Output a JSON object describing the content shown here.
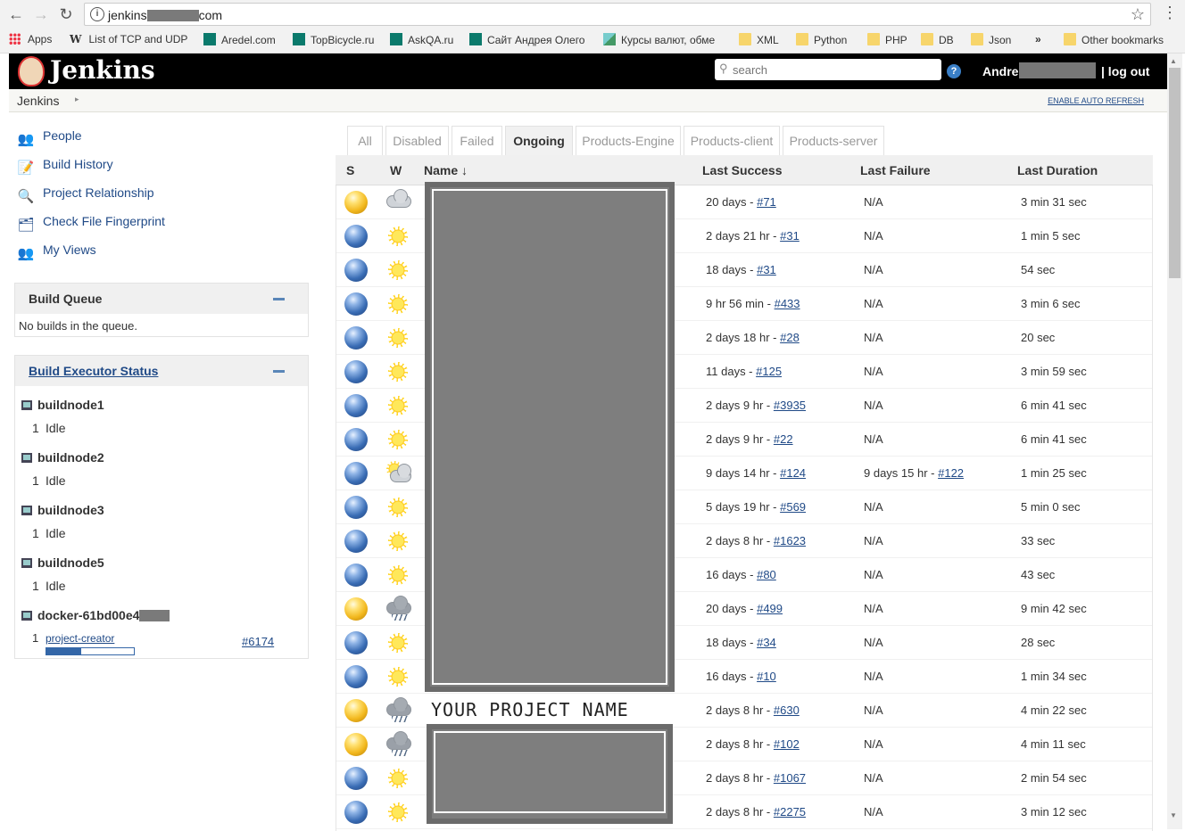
{
  "browser": {
    "url_prefix": "jenkins",
    "url_suffix": "com",
    "bookmarks": [
      {
        "label": "Apps",
        "icon": "apps-grid-icon"
      },
      {
        "label": "List of TCP and UDP",
        "icon": "wikipedia-icon"
      },
      {
        "label": "Aredel.com",
        "icon": "bookmark-icon"
      },
      {
        "label": "TopBicycle.ru",
        "icon": "bookmark-icon"
      },
      {
        "label": "AskQA.ru",
        "icon": "bookmark-icon"
      },
      {
        "label": "Сайт Андрея Олего",
        "icon": "bookmark-icon"
      },
      {
        "label": "Курсы валют, обме",
        "icon": "bookmark-icon"
      },
      {
        "label": "XML",
        "icon": "folder-icon"
      },
      {
        "label": "Python",
        "icon": "folder-icon"
      },
      {
        "label": "PHP",
        "icon": "folder-icon"
      },
      {
        "label": "DB",
        "icon": "folder-icon"
      },
      {
        "label": "Json",
        "icon": "folder-icon"
      },
      {
        "label": "»",
        "icon": "more-icon"
      },
      {
        "label": "Other bookmarks",
        "icon": "folder-icon"
      }
    ]
  },
  "header": {
    "logo_text": "Jenkins",
    "search_placeholder": "search",
    "help": "?",
    "user_name": "Andrei",
    "logout": "| log out"
  },
  "breadcrumb": {
    "home": "Jenkins",
    "arrow": "▸",
    "auto_refresh": "ENABLE AUTO REFRESH"
  },
  "sidebar": {
    "tasks": [
      {
        "label": "People",
        "icon": "people-icon"
      },
      {
        "label": "Build History",
        "icon": "notepad-icon"
      },
      {
        "label": "Project Relationship",
        "icon": "magnifier-icon"
      },
      {
        "label": "Check File Fingerprint",
        "icon": "fingerprint-icon"
      },
      {
        "label": "My Views",
        "icon": "people-icon"
      }
    ],
    "build_queue": {
      "title": "Build Queue",
      "empty_text": "No builds in the queue."
    },
    "executor_status": {
      "title": "Build Executor Status",
      "nodes": [
        {
          "name": "buildnode1",
          "exec_num": "1",
          "state": "Idle"
        },
        {
          "name": "buildnode2",
          "exec_num": "1",
          "state": "Idle"
        },
        {
          "name": "buildnode3",
          "exec_num": "1",
          "state": "Idle"
        },
        {
          "name": "buildnode5",
          "exec_num": "1",
          "state": "Idle"
        },
        {
          "name": "docker-61bd00e4",
          "exec_num": "1",
          "state": "project-creator",
          "build": "#6174",
          "progress": 0.4
        }
      ]
    }
  },
  "tabs": [
    {
      "label": "All",
      "active": false
    },
    {
      "label": "Disabled",
      "active": false
    },
    {
      "label": "Failed",
      "active": false
    },
    {
      "label": "Ongoing",
      "active": true
    },
    {
      "label": "Products-Engine",
      "active": false
    },
    {
      "label": "Products-client",
      "active": false
    },
    {
      "label": "Products-server",
      "active": false
    }
  ],
  "table": {
    "headers": {
      "status": "S",
      "weather": "W",
      "name": "Name ↓",
      "last_success": "Last Success",
      "last_failure": "Last Failure",
      "last_duration": "Last Duration"
    },
    "visible_project_name": "YOUR PROJECT NAME",
    "rows": [
      {
        "status": "yellow",
        "weather": "cloud",
        "success_time": "20 days - ",
        "success_build": "#71",
        "failure_time": "N/A",
        "failure_build": "",
        "duration": "3 min 31 sec"
      },
      {
        "status": "blue",
        "weather": "sun",
        "success_time": "2 days 21 hr - ",
        "success_build": "#31",
        "failure_time": "N/A",
        "failure_build": "",
        "duration": "1 min 5 sec"
      },
      {
        "status": "blue",
        "weather": "sun",
        "success_time": "18 days - ",
        "success_build": "#31",
        "failure_time": "N/A",
        "failure_build": "",
        "duration": "54 sec"
      },
      {
        "status": "blue",
        "weather": "sun",
        "success_time": "9 hr 56 min - ",
        "success_build": "#433",
        "failure_time": "N/A",
        "failure_build": "",
        "duration": "3 min 6 sec"
      },
      {
        "status": "blue",
        "weather": "sun",
        "success_time": "2 days 18 hr - ",
        "success_build": "#28",
        "failure_time": "N/A",
        "failure_build": "",
        "duration": "20 sec"
      },
      {
        "status": "blue",
        "weather": "sun",
        "success_time": "11 days - ",
        "success_build": "#125",
        "failure_time": "N/A",
        "failure_build": "",
        "duration": "3 min 59 sec"
      },
      {
        "status": "blue",
        "weather": "sun",
        "success_time": "2 days 9 hr - ",
        "success_build": "#3935",
        "failure_time": "N/A",
        "failure_build": "",
        "duration": "6 min 41 sec"
      },
      {
        "status": "blue",
        "weather": "sun",
        "success_time": "2 days 9 hr - ",
        "success_build": "#22",
        "failure_time": "N/A",
        "failure_build": "",
        "duration": "6 min 41 sec"
      },
      {
        "status": "blue",
        "weather": "partly-sunny",
        "success_time": "9 days 14 hr - ",
        "success_build": "#124",
        "failure_time": "9 days 15 hr - ",
        "failure_build": "#122",
        "duration": "1 min 25 sec"
      },
      {
        "status": "blue",
        "weather": "sun",
        "success_time": "5 days 19 hr - ",
        "success_build": "#569",
        "failure_time": "N/A",
        "failure_build": "",
        "duration": "5 min 0 sec"
      },
      {
        "status": "blue",
        "weather": "sun",
        "success_time": "2 days 8 hr - ",
        "success_build": "#1623",
        "failure_time": "N/A",
        "failure_build": "",
        "duration": "33 sec"
      },
      {
        "status": "blue",
        "weather": "sun",
        "success_time": "16 days - ",
        "success_build": "#80",
        "failure_time": "N/A",
        "failure_build": "",
        "duration": "43 sec"
      },
      {
        "status": "yellow",
        "weather": "rain",
        "success_time": "20 days - ",
        "success_build": "#499",
        "failure_time": "N/A",
        "failure_build": "",
        "duration": "9 min 42 sec"
      },
      {
        "status": "blue",
        "weather": "sun",
        "success_time": "18 days - ",
        "success_build": "#34",
        "failure_time": "N/A",
        "failure_build": "",
        "duration": "28 sec"
      },
      {
        "status": "blue",
        "weather": "sun",
        "success_time": "16 days - ",
        "success_build": "#10",
        "failure_time": "N/A",
        "failure_build": "",
        "duration": "1 min 34 sec"
      },
      {
        "status": "yellow",
        "weather": "rain",
        "success_time": "2 days 8 hr - ",
        "success_build": "#630",
        "failure_time": "N/A",
        "failure_build": "",
        "duration": "4 min 22 sec"
      },
      {
        "status": "yellow",
        "weather": "rain",
        "success_time": "2 days 8 hr - ",
        "success_build": "#102",
        "failure_time": "N/A",
        "failure_build": "",
        "duration": "4 min 11 sec"
      },
      {
        "status": "blue",
        "weather": "sun",
        "success_time": "2 days 8 hr - ",
        "success_build": "#1067",
        "failure_time": "N/A",
        "failure_build": "",
        "duration": "2 min 54 sec"
      },
      {
        "status": "blue",
        "weather": "sun",
        "success_time": "2 days 8 hr - ",
        "success_build": "#2275",
        "failure_time": "N/A",
        "failure_build": "",
        "duration": "3 min 12 sec"
      }
    ]
  },
  "colors": {
    "link": "#204a87",
    "header_bg": "#000000",
    "ball_blue": "#3a6db5",
    "ball_yellow": "#f2b81e"
  }
}
